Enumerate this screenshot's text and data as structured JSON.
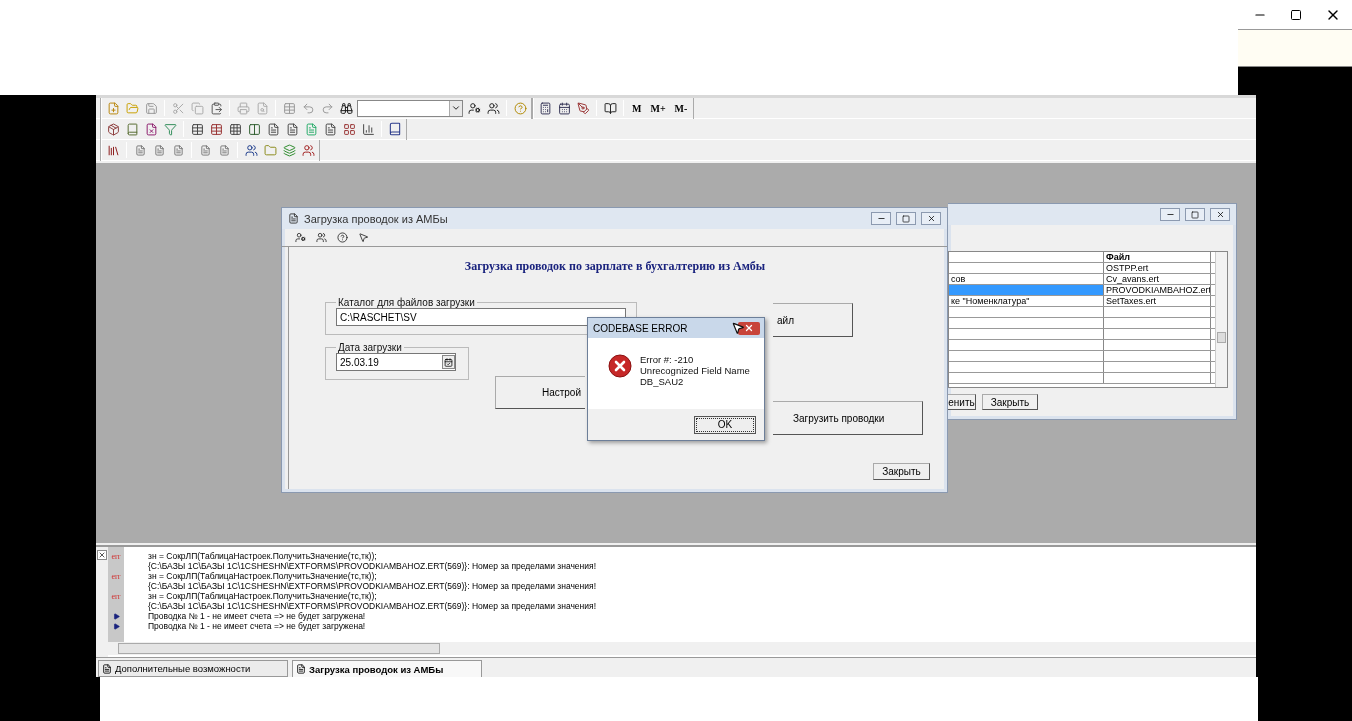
{
  "toolbar": {
    "memory_buttons": [
      "M",
      "M+",
      "M-"
    ]
  },
  "dialog": {
    "title": "Загрузка проводок из АМБы",
    "heading": "Загрузка проводок по зарплате в бухгалтерию из Амбы",
    "catalog": {
      "label": "Каталог для файлов загрузки",
      "value": "C:\\RASCHET\\SV"
    },
    "date": {
      "label": "Дата загрузки",
      "value": "25.03.19"
    },
    "buttons": [
      {
        "kind": "file",
        "label": "айл"
      },
      {
        "kind": "settings",
        "label": "Настрой"
      },
      {
        "kind": "load",
        "label": "Загрузить проводки"
      },
      {
        "kind": "close",
        "label": "Закрыть"
      }
    ]
  },
  "settings_window": {
    "header": {
      "column_2": "Файл"
    },
    "rows": [
      {
        "column_2": "OSTPP.ert",
        "selected": false
      },
      {
        "column_1": "сов",
        "column_2": "Cv_avans.ert",
        "selected": false
      },
      {
        "column_2": "PROVODKIAMBAHOZ.ert",
        "selected": true
      },
      {
        "column_1": "ке \"Номенклатура\"",
        "column_2": "SetTaxes.ert",
        "selected": false
      }
    ],
    "buttons": [
      "енить",
      "Закрыть"
    ]
  },
  "error_dialog": {
    "title": "CODEBASE ERROR",
    "message_lines": [
      "Error #: -210",
      "Unrecognized Field Name",
      "DB_SAU2"
    ],
    "button": "OK"
  },
  "log": {
    "lines": [
      {
        "kind": "error",
        "tag": "err",
        "text": "зн = СокрЛП(ТаблицаНастроек.ПолучитьЗначение(тс,тк));"
      },
      {
        "kind": "detail",
        "text": "{C:\\БАЗЫ 1С\\БАЗЫ 1С\\1CSHESHN\\EXTFORMS\\PROVODKIAMBAHOZ.ERT(569)}: Номер за пределами значения!"
      },
      {
        "kind": "error",
        "tag": "err",
        "text": "зн = СокрЛП(ТаблицаНастроек.ПолучитьЗначение(тс,тк));"
      },
      {
        "kind": "detail",
        "text": "{C:\\БАЗЫ 1С\\БАЗЫ 1С\\1CSHESHN\\EXTFORMS\\PROVODKIAMBAHOZ.ERT(569)}: Номер за пределами значения!"
      },
      {
        "kind": "error",
        "tag": "err",
        "text": "зн = СокрЛП(ТаблицаНастроек.ПолучитьЗначение(тс,тк));"
      },
      {
        "kind": "detail",
        "text": "{C:\\БАЗЫ 1С\\БАЗЫ 1С\\1CSHESHN\\EXTFORMS\\PROVODKIAMBAHOZ.ERT(569)}: Номер за пределами значения!"
      },
      {
        "kind": "info",
        "text": "Проводка № 1 - не имеет счета => не будет загружена!"
      },
      {
        "kind": "info",
        "text": "Проводка № 1 - не имеет счета => не будет загружена!"
      }
    ]
  },
  "tabs": [
    {
      "label": "Дополнительные возможности",
      "selected": false
    },
    {
      "label": "Загрузка проводок из АМБы",
      "selected": true
    }
  ]
}
